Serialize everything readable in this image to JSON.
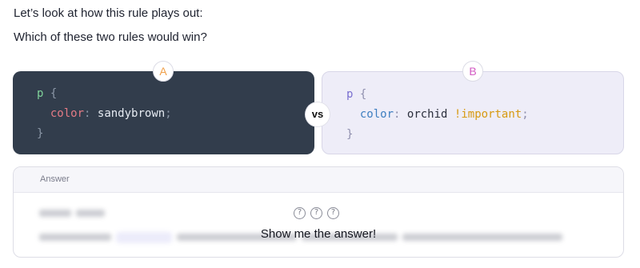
{
  "intro": {
    "line1": "Let’s look at how this rule plays out:",
    "line2": "Which of these two rules would win?"
  },
  "rule_a": {
    "badge": "A",
    "selector": "p",
    "open_brace": "{",
    "property": "color",
    "colon": ":",
    "value": "sandybrown",
    "semicolon": ";",
    "close_brace": "}"
  },
  "rule_b": {
    "badge": "B",
    "selector": "p",
    "open_brace": "{",
    "property": "color",
    "colon": ":",
    "value": "orchid",
    "important": "!important",
    "semicolon": ";",
    "close_brace": "}"
  },
  "versus_label": "vs",
  "answer": {
    "header": "Answer",
    "reveal_label": "Show me the answer!",
    "help_icons": [
      "?",
      "?",
      "?"
    ]
  },
  "colors": {
    "card_a_bg": "#323d4c",
    "card_b_bg": "#eeedf8",
    "badge_a": "#f0a04a",
    "badge_b": "#d35cc4",
    "important": "#d79a12"
  }
}
